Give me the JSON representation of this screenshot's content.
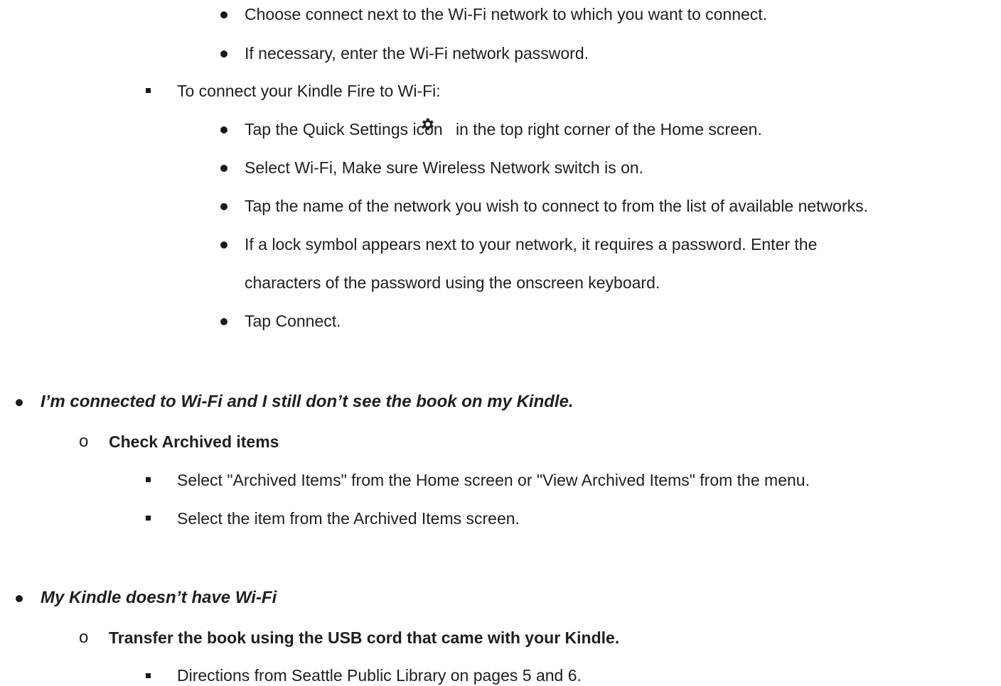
{
  "lines": {
    "l1": "Choose connect next to the Wi-Fi network to which you want to connect.",
    "l2": "If necessary, enter the Wi-Fi network password.",
    "l3": "To connect your Kindle Fire to Wi-Fi:",
    "l4a": "Tap the Quick Settings icon",
    "l4b": "in the top right corner of the Home screen.",
    "l5": "Select Wi-Fi, Make sure Wireless Network switch is on.",
    "l6": "Tap the name of the network you wish to connect to from the list of available networks.",
    "l7": "If a lock symbol appears next to your network, it requires a password. Enter the",
    "l7b": "characters of the password using the onscreen keyboard.",
    "l8": "Tap Connect.",
    "h1": "I’m connected to Wi-Fi and I still don’t see the book on my Kindle.",
    "s1": "Check Archived items",
    "l9": "Select \"Archived Items\" from the Home screen or \"View Archived Items\" from the menu.",
    "l10": "Select the item from the Archived Items screen.",
    "h2": "My Kindle doesn’t have Wi-Fi",
    "s2": "Transfer the book using the USB cord that came with your Kindle.",
    "l11": "Directions from Seattle Public Library on pages 5 and 6."
  },
  "sub_bullet_glyph": "o",
  "icons": {
    "quick_settings": "gear-icon"
  }
}
